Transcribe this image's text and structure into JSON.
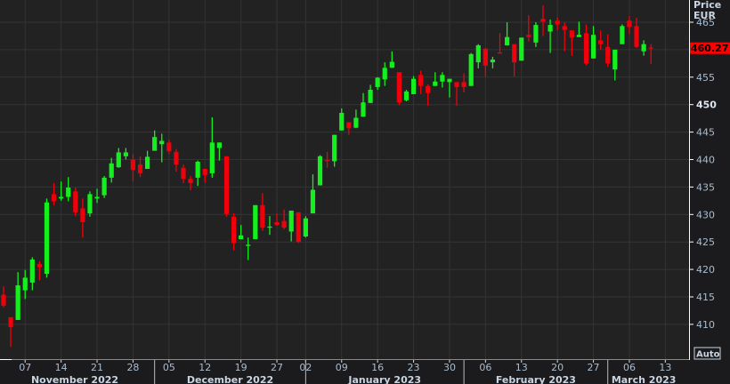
{
  "header": {
    "price_label": "Price",
    "currency_label": "EUR"
  },
  "last_price": {
    "label": "460.27",
    "value": 460.27,
    "color": "#ff0000"
  },
  "auto_button": {
    "label": "Auto"
  },
  "colors": {
    "up": "#14f01e",
    "down": "#f0000a",
    "background": "#222222",
    "grid": "#343434"
  },
  "chart_data": {
    "type": "candlestick",
    "title": "",
    "xlabel": "",
    "ylabel": "Price EUR",
    "ylim": [
      406,
      468
    ],
    "grid": true,
    "y_ticks": [
      {
        "value": 465,
        "label": "465"
      },
      {
        "value": 455,
        "label": "455"
      },
      {
        "value": 450,
        "label": "450",
        "bold": true
      },
      {
        "value": 445,
        "label": "445"
      },
      {
        "value": 440,
        "label": "440"
      },
      {
        "value": 435,
        "label": "435"
      },
      {
        "value": 430,
        "label": "430"
      },
      {
        "value": 425,
        "label": "425"
      },
      {
        "value": 420,
        "label": "420"
      },
      {
        "value": 415,
        "label": "415"
      },
      {
        "value": 410,
        "label": "410"
      }
    ],
    "x_ticks": [
      {
        "index": 3,
        "label": "07"
      },
      {
        "index": 8,
        "label": "14"
      },
      {
        "index": 13,
        "label": "21"
      },
      {
        "index": 18,
        "label": "28"
      },
      {
        "index": 23,
        "label": "05"
      },
      {
        "index": 28,
        "label": "12"
      },
      {
        "index": 33,
        "label": "19"
      },
      {
        "index": 38,
        "label": "27"
      },
      {
        "index": 42,
        "label": "02"
      },
      {
        "index": 47,
        "label": "09"
      },
      {
        "index": 52,
        "label": "16"
      },
      {
        "index": 57,
        "label": "23"
      },
      {
        "index": 62,
        "label": "30"
      },
      {
        "index": 67,
        "label": "06"
      },
      {
        "index": 72,
        "label": "13"
      },
      {
        "index": 77,
        "label": "20"
      },
      {
        "index": 82,
        "label": "27"
      },
      {
        "index": 87,
        "label": "06"
      },
      {
        "index": 92,
        "label": "13"
      }
    ],
    "months": [
      {
        "label": "November 2022",
        "start": 0,
        "end": 21
      },
      {
        "label": "December 2022",
        "start": 21,
        "end": 42
      },
      {
        "label": "January 2023",
        "start": 42,
        "end": 64
      },
      {
        "label": "February 2023",
        "start": 64,
        "end": 84
      },
      {
        "label": "March 2023",
        "start": 84,
        "end": 94
      }
    ],
    "ohlc_fields": [
      "open",
      "high",
      "low",
      "close"
    ],
    "candles": [
      [
        415.4,
        416.9,
        413.1,
        413.4
      ],
      [
        411.3,
        411.3,
        405.9,
        409.5
      ],
      [
        410.8,
        419.5,
        410.8,
        417.1
      ],
      [
        416.2,
        419.9,
        414.6,
        418.5
      ],
      [
        417.6,
        422.2,
        416.2,
        421.8
      ],
      [
        421.0,
        421.5,
        418.0,
        420.4
      ],
      [
        419.2,
        432.9,
        418.5,
        432.2
      ],
      [
        433.7,
        435.7,
        431.7,
        432.4
      ],
      [
        432.9,
        436.0,
        432.5,
        433.2
      ],
      [
        433.2,
        436.8,
        432.4,
        434.9
      ],
      [
        434.2,
        434.9,
        429.7,
        430.4
      ],
      [
        431.1,
        432.9,
        425.8,
        428.6
      ],
      [
        430.2,
        434.2,
        429.6,
        433.7
      ],
      [
        432.9,
        434.7,
        432.1,
        433.2
      ],
      [
        433.5,
        437.0,
        433.0,
        436.7
      ],
      [
        436.7,
        440.3,
        435.8,
        439.3
      ],
      [
        438.6,
        442.1,
        438.5,
        441.3
      ],
      [
        440.6,
        442.1,
        440.0,
        441.3
      ],
      [
        440.0,
        441.0,
        436.1,
        438.1
      ],
      [
        439.1,
        440.6,
        436.8,
        437.5
      ],
      [
        438.3,
        441.6,
        438.3,
        440.5
      ],
      [
        441.6,
        445.3,
        441.6,
        444.1
      ],
      [
        442.8,
        444.7,
        439.5,
        443.4
      ],
      [
        443.1,
        443.6,
        441.0,
        441.5
      ],
      [
        441.4,
        441.9,
        437.8,
        439.1
      ],
      [
        438.5,
        439.1,
        435.7,
        436.5
      ],
      [
        436.5,
        437.0,
        434.4,
        435.7
      ],
      [
        436.7,
        439.8,
        435.2,
        439.6
      ],
      [
        438.3,
        438.3,
        435.8,
        437.2
      ],
      [
        437.5,
        447.7,
        436.7,
        443.1
      ],
      [
        442.1,
        443.1,
        439.8,
        443.1
      ],
      [
        440.6,
        440.6,
        429.6,
        430.1
      ],
      [
        429.6,
        430.2,
        423.5,
        424.8
      ],
      [
        425.5,
        428.1,
        425.5,
        426.2
      ],
      [
        424.3,
        425.8,
        421.7,
        424.5
      ],
      [
        425.5,
        431.7,
        425.5,
        431.7
      ],
      [
        431.7,
        433.9,
        427.0,
        427.6
      ],
      [
        427.7,
        429.7,
        426.3,
        427.8
      ],
      [
        428.6,
        430.2,
        427.9,
        428.1
      ],
      [
        428.8,
        430.9,
        427.3,
        427.6
      ],
      [
        426.9,
        430.7,
        425.1,
        430.7
      ],
      [
        430.4,
        430.4,
        424.8,
        425.0
      ],
      [
        426.0,
        429.7,
        425.8,
        429.3
      ],
      [
        430.2,
        437.3,
        430.2,
        434.5
      ],
      [
        435.3,
        440.8,
        435.3,
        440.6
      ],
      [
        439.9,
        441.4,
        438.5,
        439.8
      ],
      [
        439.7,
        444.5,
        438.7,
        444.5
      ],
      [
        445.3,
        449.3,
        445.3,
        448.5
      ],
      [
        446.8,
        446.8,
        444.5,
        445.7
      ],
      [
        445.8,
        449.1,
        445.7,
        447.6
      ],
      [
        447.8,
        452.1,
        447.8,
        450.4
      ],
      [
        450.3,
        453.6,
        450.3,
        452.7
      ],
      [
        453.2,
        455.0,
        452.7,
        454.9
      ],
      [
        454.6,
        457.7,
        453.4,
        456.7
      ],
      [
        456.7,
        459.7,
        456.7,
        457.8
      ],
      [
        455.9,
        455.9,
        449.9,
        450.4
      ],
      [
        450.8,
        452.7,
        450.6,
        452.4
      ],
      [
        451.9,
        455.2,
        451.9,
        454.7
      ],
      [
        455.4,
        456.2,
        451.9,
        453.4
      ],
      [
        453.4,
        453.7,
        449.8,
        452.1
      ],
      [
        453.4,
        455.9,
        453.4,
        454.2
      ],
      [
        454.2,
        455.9,
        453.1,
        455.4
      ],
      [
        454.1,
        454.7,
        451.3,
        454.7
      ],
      [
        454.1,
        454.1,
        449.8,
        453.2
      ],
      [
        454.1,
        455.7,
        452.2,
        453.2
      ],
      [
        453.4,
        459.4,
        453.4,
        459.2
      ],
      [
        457.7,
        461.0,
        456.6,
        460.8
      ],
      [
        460.2,
        460.2,
        455.1,
        457.1
      ],
      [
        457.7,
        458.7,
        456.6,
        458.2
      ],
      [
        459.5,
        463.0,
        459.4,
        459.4
      ],
      [
        460.8,
        465.0,
        460.8,
        462.3
      ],
      [
        461.0,
        461.0,
        455.1,
        457.7
      ],
      [
        458.0,
        462.2,
        458.0,
        462.2
      ],
      [
        462.7,
        466.3,
        461.5,
        462.3
      ],
      [
        461.3,
        465.0,
        460.5,
        464.5
      ],
      [
        465.6,
        468.1,
        462.5,
        465.1
      ],
      [
        463.3,
        465.5,
        459.4,
        464.5
      ],
      [
        465.3,
        465.9,
        463.5,
        464.6
      ],
      [
        464.3,
        465.0,
        459.7,
        463.6
      ],
      [
        463.5,
        463.5,
        458.9,
        462.2
      ],
      [
        462.3,
        465.1,
        462.3,
        462.7
      ],
      [
        463.0,
        464.6,
        457.2,
        457.5
      ],
      [
        458.4,
        464.3,
        458.4,
        462.7
      ],
      [
        461.7,
        463.5,
        460.0,
        461.0
      ],
      [
        460.5,
        462.8,
        456.9,
        457.5
      ],
      [
        456.4,
        460.0,
        454.4,
        460.0
      ],
      [
        461.0,
        464.6,
        461.0,
        464.3
      ],
      [
        465.3,
        466.1,
        462.8,
        464.1
      ],
      [
        464.3,
        465.8,
        460.3,
        460.5
      ],
      [
        459.7,
        461.7,
        458.9,
        461.0
      ],
      [
        460.4,
        461.0,
        457.4,
        460.27
      ]
    ]
  }
}
